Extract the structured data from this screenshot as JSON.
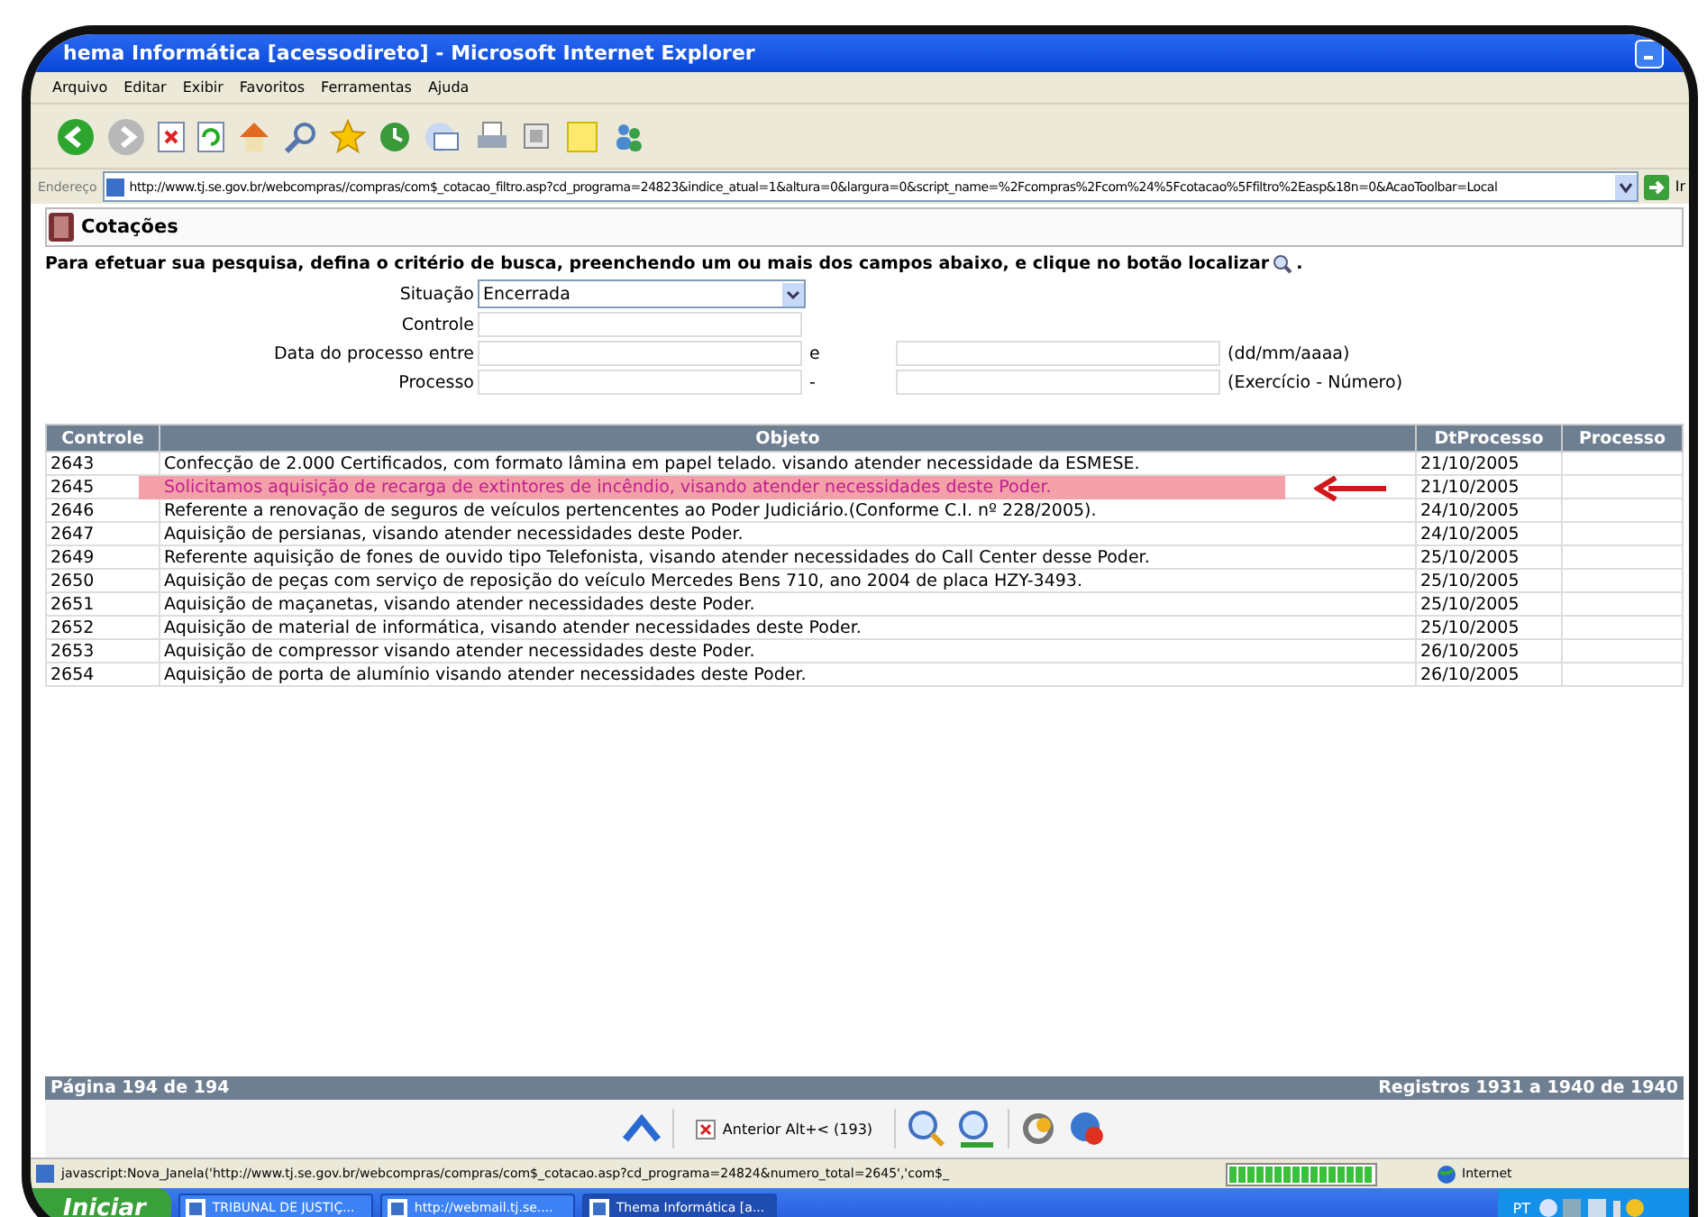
{
  "window": {
    "title": "hema Informática [acessodireto] - Microsoft Internet Explorer"
  },
  "menu": [
    "Arquivo",
    "Editar",
    "Exibir",
    "Favoritos",
    "Ferramentas",
    "Ajuda"
  ],
  "address": {
    "label": "Endereço",
    "value": "http://www.tj.se.gov.br/webcompras//compras/com$_cotacao_filtro.asp?cd_programa=24823&indice_atual=1&altura=0&largura=0&script_name=%2Fcompras%2Fcom%24%5Fcotacao%5Ffiltro%2Easp&18n=0&AcaoToolbar=Local",
    "go": "Ir"
  },
  "page_title": "Cotações",
  "instruction": "Para efetuar sua pesquisa, defina o critério de busca, preenchendo um ou mais dos campos abaixo, e clique no botão localizar",
  "instruction_end": ".",
  "form": [
    {
      "kind": "select",
      "label": "Situação",
      "value": "Encerrada"
    },
    {
      "kind": "text",
      "label": "Controle"
    },
    {
      "kind": "range",
      "label": "Data do processo entre",
      "separator": "e",
      "hint": "(dd/mm/aaaa)"
    },
    {
      "kind": "range",
      "label": "Processo",
      "separator": "-",
      "hint": "(Exercício - Número)"
    }
  ],
  "table": {
    "columns": [
      "Controle",
      "Objeto",
      "DtProcesso",
      "Processo"
    ],
    "rows": [
      {
        "controle": "2643",
        "objeto": "Confecção de 2.000 Certificados, com formato lâmina em papel telado. visando atender necessidade da ESMESE.",
        "data": "21/10/2005",
        "highlighted": false
      },
      {
        "controle": "2645",
        "objeto": "Solicitamos aquisição de recarga de extintores de incêndio, visando atender necessidades deste Poder.",
        "data": "21/10/2005",
        "highlighted": true
      },
      {
        "controle": "2646",
        "objeto": "Referente a renovação de seguros de veículos pertencentes ao Poder Judiciário.(Conforme C.I. nº 228/2005).",
        "data": "24/10/2005",
        "highlighted": false
      },
      {
        "controle": "2647",
        "objeto": "Aquisição de persianas, visando atender necessidades deste Poder.",
        "data": "24/10/2005",
        "highlighted": false
      },
      {
        "controle": "2649",
        "objeto": "Referente aquisição de fones de ouvido tipo Telefonista, visando atender necessidades do Call Center desse Poder.",
        "data": "25/10/2005",
        "highlighted": false
      },
      {
        "controle": "2650",
        "objeto": "Aquisição de peças com serviço de reposição do veículo Mercedes Bens 710, ano 2004 de placa HZY-3493.",
        "data": "25/10/2005",
        "highlighted": false
      },
      {
        "controle": "2651",
        "objeto": "Aquisição de maçanetas, visando atender necessidades deste Poder.",
        "data": "25/10/2005",
        "highlighted": false
      },
      {
        "controle": "2652",
        "objeto": "Aquisição de material de informática, visando atender necessidades deste Poder.",
        "data": "25/10/2005",
        "highlighted": false
      },
      {
        "controle": "2653",
        "objeto": "Aquisição de compressor visando atender necessidades deste Poder.",
        "data": "26/10/2005",
        "highlighted": false
      },
      {
        "controle": "2654",
        "objeto": "Aquisição de porta de alumínio visando atender necessidades deste Poder.",
        "data": "26/10/2005",
        "highlighted": false
      }
    ]
  },
  "pager": {
    "page": "Página 194 de 194",
    "records": "Registros 1931 a 1940 de 1940",
    "previous": "Anterior Alt+< (193)"
  },
  "status_bar": {
    "text": "javascript:Nova_Janela('http://www.tj.se.gov.br/webcompras/compras/com$_cotacao.asp?cd_programa=24824&numero_total=2645','com$_",
    "progress": {
      "level": 1
    },
    "zone": "Internet"
  },
  "taskbar": {
    "start": "Iniciar",
    "tasks": [
      {
        "label": "TRIBUNAL DE JUSTIÇ...",
        "selected": false
      },
      {
        "label": "http://webmail.tj.se....",
        "selected": false
      },
      {
        "label": "Thema Informática [a...",
        "selected": true
      }
    ],
    "language": "PT"
  }
}
